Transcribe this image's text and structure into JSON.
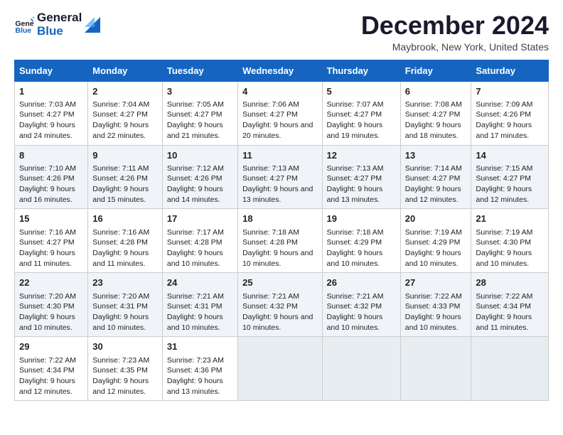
{
  "logo": {
    "line1": "General",
    "line2": "Blue"
  },
  "title": "December 2024",
  "subtitle": "Maybrook, New York, United States",
  "days_header": [
    "Sunday",
    "Monday",
    "Tuesday",
    "Wednesday",
    "Thursday",
    "Friday",
    "Saturday"
  ],
  "weeks": [
    [
      {
        "day": "1",
        "sunrise": "7:03 AM",
        "sunset": "4:27 PM",
        "daylight": "9 hours and 24 minutes."
      },
      {
        "day": "2",
        "sunrise": "7:04 AM",
        "sunset": "4:27 PM",
        "daylight": "9 hours and 22 minutes."
      },
      {
        "day": "3",
        "sunrise": "7:05 AM",
        "sunset": "4:27 PM",
        "daylight": "9 hours and 21 minutes."
      },
      {
        "day": "4",
        "sunrise": "7:06 AM",
        "sunset": "4:27 PM",
        "daylight": "9 hours and 20 minutes."
      },
      {
        "day": "5",
        "sunrise": "7:07 AM",
        "sunset": "4:27 PM",
        "daylight": "9 hours and 19 minutes."
      },
      {
        "day": "6",
        "sunrise": "7:08 AM",
        "sunset": "4:27 PM",
        "daylight": "9 hours and 18 minutes."
      },
      {
        "day": "7",
        "sunrise": "7:09 AM",
        "sunset": "4:26 PM",
        "daylight": "9 hours and 17 minutes."
      }
    ],
    [
      {
        "day": "8",
        "sunrise": "7:10 AM",
        "sunset": "4:26 PM",
        "daylight": "9 hours and 16 minutes."
      },
      {
        "day": "9",
        "sunrise": "7:11 AM",
        "sunset": "4:26 PM",
        "daylight": "9 hours and 15 minutes."
      },
      {
        "day": "10",
        "sunrise": "7:12 AM",
        "sunset": "4:26 PM",
        "daylight": "9 hours and 14 minutes."
      },
      {
        "day": "11",
        "sunrise": "7:13 AM",
        "sunset": "4:27 PM",
        "daylight": "9 hours and 13 minutes."
      },
      {
        "day": "12",
        "sunrise": "7:13 AM",
        "sunset": "4:27 PM",
        "daylight": "9 hours and 13 minutes."
      },
      {
        "day": "13",
        "sunrise": "7:14 AM",
        "sunset": "4:27 PM",
        "daylight": "9 hours and 12 minutes."
      },
      {
        "day": "14",
        "sunrise": "7:15 AM",
        "sunset": "4:27 PM",
        "daylight": "9 hours and 12 minutes."
      }
    ],
    [
      {
        "day": "15",
        "sunrise": "7:16 AM",
        "sunset": "4:27 PM",
        "daylight": "9 hours and 11 minutes."
      },
      {
        "day": "16",
        "sunrise": "7:16 AM",
        "sunset": "4:28 PM",
        "daylight": "9 hours and 11 minutes."
      },
      {
        "day": "17",
        "sunrise": "7:17 AM",
        "sunset": "4:28 PM",
        "daylight": "9 hours and 10 minutes."
      },
      {
        "day": "18",
        "sunrise": "7:18 AM",
        "sunset": "4:28 PM",
        "daylight": "9 hours and 10 minutes."
      },
      {
        "day": "19",
        "sunrise": "7:18 AM",
        "sunset": "4:29 PM",
        "daylight": "9 hours and 10 minutes."
      },
      {
        "day": "20",
        "sunrise": "7:19 AM",
        "sunset": "4:29 PM",
        "daylight": "9 hours and 10 minutes."
      },
      {
        "day": "21",
        "sunrise": "7:19 AM",
        "sunset": "4:30 PM",
        "daylight": "9 hours and 10 minutes."
      }
    ],
    [
      {
        "day": "22",
        "sunrise": "7:20 AM",
        "sunset": "4:30 PM",
        "daylight": "9 hours and 10 minutes."
      },
      {
        "day": "23",
        "sunrise": "7:20 AM",
        "sunset": "4:31 PM",
        "daylight": "9 hours and 10 minutes."
      },
      {
        "day": "24",
        "sunrise": "7:21 AM",
        "sunset": "4:31 PM",
        "daylight": "9 hours and 10 minutes."
      },
      {
        "day": "25",
        "sunrise": "7:21 AM",
        "sunset": "4:32 PM",
        "daylight": "9 hours and 10 minutes."
      },
      {
        "day": "26",
        "sunrise": "7:21 AM",
        "sunset": "4:32 PM",
        "daylight": "9 hours and 10 minutes."
      },
      {
        "day": "27",
        "sunrise": "7:22 AM",
        "sunset": "4:33 PM",
        "daylight": "9 hours and 10 minutes."
      },
      {
        "day": "28",
        "sunrise": "7:22 AM",
        "sunset": "4:34 PM",
        "daylight": "9 hours and 11 minutes."
      }
    ],
    [
      {
        "day": "29",
        "sunrise": "7:22 AM",
        "sunset": "4:34 PM",
        "daylight": "9 hours and 12 minutes."
      },
      {
        "day": "30",
        "sunrise": "7:23 AM",
        "sunset": "4:35 PM",
        "daylight": "9 hours and 12 minutes."
      },
      {
        "day": "31",
        "sunrise": "7:23 AM",
        "sunset": "4:36 PM",
        "daylight": "9 hours and 13 minutes."
      },
      null,
      null,
      null,
      null
    ]
  ],
  "labels": {
    "sunrise": "Sunrise:",
    "sunset": "Sunset:",
    "daylight": "Daylight:"
  }
}
